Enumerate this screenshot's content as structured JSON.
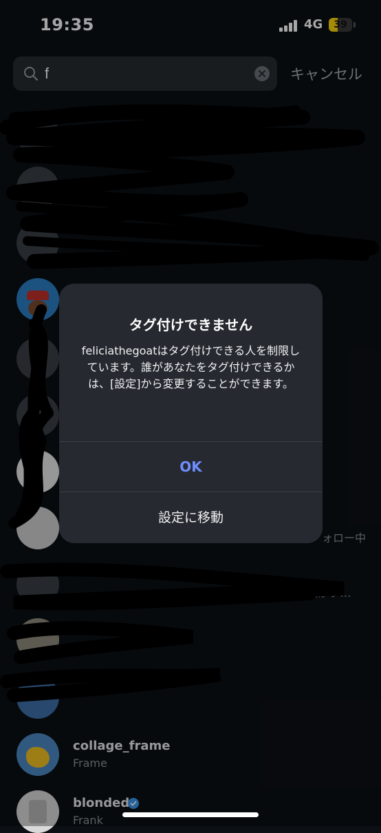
{
  "status_bar": {
    "time": "19:35",
    "network": "4G",
    "battery_level": "39",
    "battery_color": "#ffd60a"
  },
  "search": {
    "query": "f",
    "placeholder": "",
    "cancel_label": "キャンセル",
    "search_icon": "search-icon",
    "clear_icon": "clear-icon"
  },
  "results": {
    "partial_following_label": "ォロー中",
    "partial_followers_label": "47人がフ…",
    "items": [
      {
        "username": "collage_frame",
        "subtitle": "Frame",
        "verified": false
      },
      {
        "username": "blonded",
        "subtitle": "Frank",
        "verified": true
      }
    ]
  },
  "dialog": {
    "title": "タグ付けできません",
    "message": "feliciathegoatはタグ付けできる人を制限しています。誰があなたをタグ付けできるかは、[設定]から変更することができます。",
    "ok_label": "OK",
    "settings_label": "設定に移動"
  },
  "colors": {
    "background": "#0c1014",
    "dialog": "#262a30",
    "accent": "#6f8dff",
    "verified": "#3897f0"
  }
}
